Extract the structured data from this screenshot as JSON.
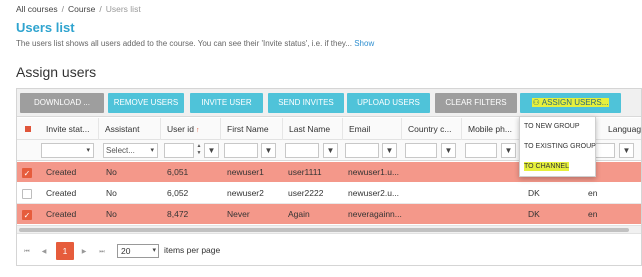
{
  "breadcrumb": {
    "items": [
      "All courses",
      "Course"
    ],
    "current": "Users list",
    "separator": "/"
  },
  "page": {
    "title": "Users list",
    "description": "The users list shows all users added to the course. You can see their 'Invite status', i.e. if they...",
    "show_link": "Show",
    "section_title": "Assign users"
  },
  "toolbar": {
    "download": "DOWNLOAD ...",
    "remove_users": "REMOVE USERS",
    "invite_user": "INVITE USER",
    "send_invites": "SEND INVITES",
    "upload_users": "UPLOAD USERS",
    "clear_filters": "CLEAR FILTERS",
    "assign_users": "ASSIGN USERS...",
    "assign_glyph": "⚇"
  },
  "columns": [
    "Invite stat...",
    "Assistant",
    "User id",
    "First Name",
    "Last Name",
    "Email",
    "Country c...",
    "Mobile ph...",
    "Language"
  ],
  "sort_arrow": "↑",
  "filters": {
    "assistant_placeholder": "Select...",
    "filter_icon": "▼",
    "caret": "▾",
    "spin_up": "▲",
    "spin_down": "▼"
  },
  "rows": [
    {
      "selected": true,
      "checkmark": "✓",
      "invite_status": "Created",
      "assistant": "No",
      "user_id": "6,051",
      "first_name": "newuser1",
      "last_name": "user1111",
      "email": "newuser1.u...",
      "country": "",
      "mobile": "",
      "country_code": "",
      "language": ""
    },
    {
      "selected": false,
      "checkmark": "",
      "invite_status": "Created",
      "assistant": "No",
      "user_id": "6,052",
      "first_name": "newuser2",
      "last_name": "user2222",
      "email": "newuser2.u...",
      "country": "",
      "mobile": "",
      "country_code": "DK",
      "language": "en"
    },
    {
      "selected": true,
      "checkmark": "✓",
      "invite_status": "Created",
      "assistant": "No",
      "user_id": "8,472",
      "first_name": "Never",
      "last_name": "Again",
      "email": "neveragainn...",
      "country": "",
      "mobile": "",
      "country_code": "DK",
      "language": "en"
    }
  ],
  "pager": {
    "first": "⏮",
    "prev": "◀",
    "current_page": "1",
    "next": "▶",
    "last": "⏭",
    "page_size": "20",
    "page_size_label": "items per page"
  },
  "assign_menu": {
    "items": [
      "TO NEW GROUP",
      "TO EXISTING GROUP",
      "TO CHANNEL"
    ]
  },
  "colors": {
    "accent": "#4fc3d9",
    "selected_row": "#f4988a",
    "highlight": "#e6f03c",
    "pager_active": "#e65c3c"
  }
}
